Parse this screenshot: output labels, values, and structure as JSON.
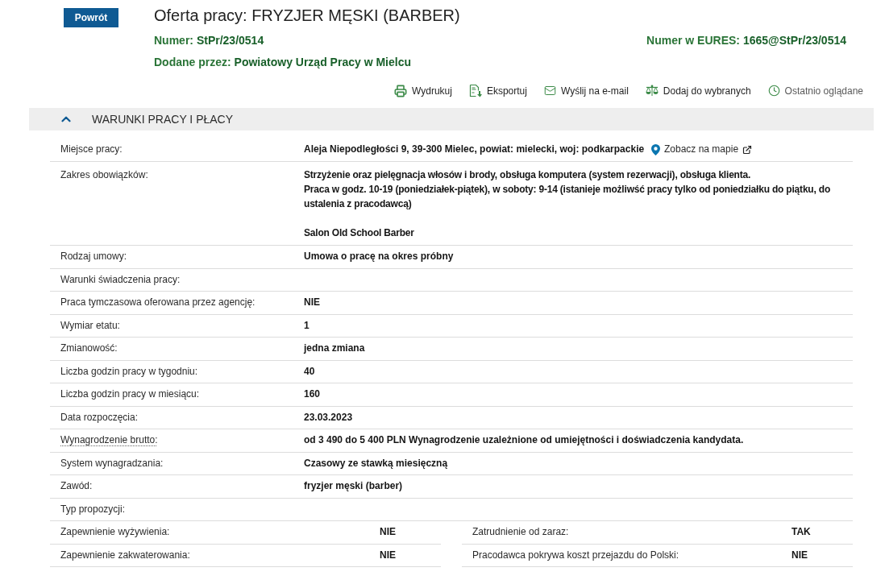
{
  "back_button": "Powrót",
  "title": "Oferta pracy: FRYZJER MĘSKI (BARBER)",
  "offer_number": {
    "label": "Numer:",
    "value": "StPr/23/0514"
  },
  "eures_number": {
    "label": "Numer w EURES:",
    "value": "1665@StPr/23/0514"
  },
  "added_by": {
    "label": "Dodane przez:",
    "value": "Powiatowy Urząd Pracy w Mielcu"
  },
  "actions": [
    {
      "kind": "print",
      "label": "Wydrukuj"
    },
    {
      "kind": "export",
      "label": "Eksportuj"
    },
    {
      "kind": "email",
      "label": "Wyślij na e-mail"
    },
    {
      "kind": "compare",
      "label": "Dodaj do wybranych"
    },
    {
      "kind": "recent",
      "label": "Ostatnio oglądane"
    }
  ],
  "section": {
    "title": "WARUNKI PRACY I PŁACY",
    "expanded": true,
    "rows": [
      {
        "kind": "field",
        "label": "Miejsce pracy:",
        "tooltip": false,
        "value": "Aleja Niepodległości 9, 39-300 Mielec, powiat: mielecki, woj: podkarpackie",
        "map_link": "Zobacz na mapie"
      },
      {
        "kind": "text",
        "label": "Zakres obowiązków:",
        "tooltip": false,
        "paragraphs": [
          [
            "Strzyżenie oraz pielęgnacja włosów i brody, obsługa komputera (system rezerwacji), obsługa klienta.",
            "Praca w godz. 10-19 (poniedziałek-piątek), w soboty: 9-14 (istanieje możliwść pracy tylko od poniedziałku do piątku, do ustalenia z pracodawcą)"
          ],
          [
            "Salon Old School Barber"
          ]
        ]
      },
      {
        "kind": "field",
        "label": "Rodzaj umowy:",
        "tooltip": false,
        "value": "Umowa o pracę na okres próbny"
      },
      {
        "kind": "field",
        "label": "Warunki świadczenia pracy:",
        "tooltip": false
      },
      {
        "kind": "field",
        "label": "Praca tymczasowa oferowana przez agencję:",
        "tooltip": false,
        "value": "NIE"
      },
      {
        "kind": "field",
        "label": "Wymiar etatu:",
        "tooltip": false,
        "value": "1"
      },
      {
        "kind": "field",
        "label": "Zmianowość:",
        "tooltip": false,
        "value": "jedna zmiana"
      },
      {
        "kind": "field",
        "label": "Liczba godzin pracy w tygodniu:",
        "tooltip": false,
        "value": "40"
      },
      {
        "kind": "field",
        "label": "Liczba godzin pracy w miesiącu:",
        "tooltip": false,
        "value": "160"
      },
      {
        "kind": "field",
        "label": "Data rozpoczęcia:",
        "tooltip": false,
        "value": "23.03.2023"
      },
      {
        "kind": "field",
        "label": "Wynagrodzenie brutto:",
        "tooltip": true,
        "value": "od 3 490 do 5 400 PLN Wynagrodzenie uzależnione od umiejętności i doświadczenia kandydata."
      },
      {
        "kind": "field",
        "label": "System wynagradzania:",
        "tooltip": false,
        "value": "Czasowy ze stawką miesięczną"
      },
      {
        "kind": "field",
        "label": "Zawód:",
        "tooltip": false,
        "value": "fryzjer męski (barber)"
      },
      {
        "kind": "field",
        "label": "Typ propozycji:",
        "tooltip": false
      },
      {
        "kind": "pair",
        "items": [
          {
            "label": "Zapewnienie wyżywienia:",
            "value": "NIE"
          },
          {
            "label": "Zatrudnienie od zaraz:",
            "value": "TAK"
          }
        ]
      },
      {
        "kind": "pair",
        "items": [
          {
            "label": "Zapewnienie zakwaterowania:",
            "value": "NIE"
          },
          {
            "label": "Pracodawca pokrywa koszt przejazdu do Polski:",
            "value": "NIE"
          }
        ]
      }
    ]
  }
}
